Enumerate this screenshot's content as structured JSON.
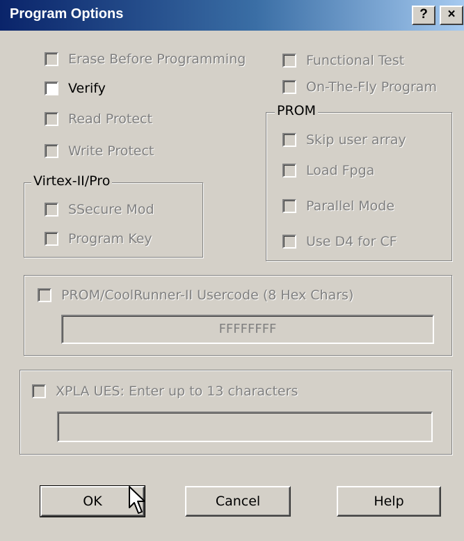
{
  "window": {
    "title": "Program Options",
    "help_button": "?",
    "close_button": "×"
  },
  "options": {
    "erase_before_programming": "Erase Before Programming",
    "verify": "Verify",
    "read_protect": "Read Protect",
    "write_protect": "Write Protect",
    "functional_test": "Functional Test",
    "on_the_fly_program": "On-The-Fly Program"
  },
  "virtex_group": {
    "label": "Virtex-II/Pro",
    "ssecure_mod": "SSecure Mod",
    "program_key": "Program Key"
  },
  "prom_group": {
    "label": "PROM",
    "skip_user_array": "Skip user array",
    "load_fpga": "Load Fpga",
    "parallel_mode": "Parallel Mode",
    "use_d4_for_cf": "Use D4 for CF"
  },
  "usercode": {
    "label": "PROM/CoolRunner-II Usercode (8 Hex Chars)",
    "value": "FFFFFFFF"
  },
  "xpla": {
    "label": "XPLA UES: Enter up to  13  characters",
    "value": ""
  },
  "buttons": {
    "ok": "OK",
    "cancel": "Cancel",
    "help": "Help"
  },
  "colors": {
    "title_start": "#0a246a",
    "title_end": "#a6caf0",
    "face": "#d4d0c8",
    "disabled_text": "#808080"
  }
}
